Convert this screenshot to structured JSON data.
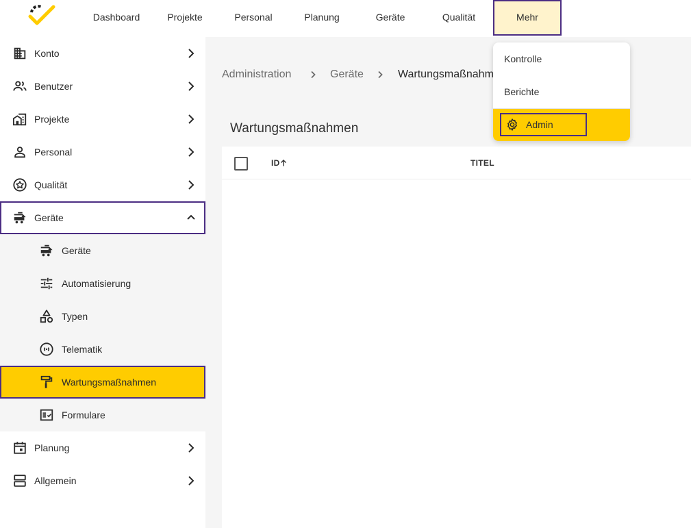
{
  "theme": {
    "accent": "#ffcc00",
    "highlight_border": "#4b2d83",
    "active_tab_bg": "#fff3cc",
    "content_bg": "#f5f5f5"
  },
  "topnav": {
    "items": [
      {
        "label": "Dashboard"
      },
      {
        "label": "Projekte"
      },
      {
        "label": "Personal"
      },
      {
        "label": "Planung"
      },
      {
        "label": "Geräte"
      },
      {
        "label": "Qualität"
      },
      {
        "label": "Mehr"
      }
    ],
    "active_index": 6
  },
  "dropdown": {
    "items": [
      {
        "label": "Kontrolle",
        "icon": ""
      },
      {
        "label": "Berichte",
        "icon": ""
      },
      {
        "label": "Admin",
        "icon": "gear-icon"
      }
    ]
  },
  "sidebar": {
    "items": [
      {
        "label": "Konto",
        "icon": "building-icon"
      },
      {
        "label": "Benutzer",
        "icon": "users-icon"
      },
      {
        "label": "Projekte",
        "icon": "buildings-icon"
      },
      {
        "label": "Personal",
        "icon": "person-icon"
      },
      {
        "label": "Qualität",
        "icon": "star-badge-icon"
      },
      {
        "label": "Geräte",
        "icon": "truck-icon",
        "expanded": true
      },
      {
        "label": "Planung",
        "icon": "calendar-icon"
      },
      {
        "label": "Allgemein",
        "icon": "storage-icon"
      }
    ],
    "sub_items": [
      {
        "label": "Geräte",
        "icon": "truck-icon"
      },
      {
        "label": "Automatisierung",
        "icon": "sliders-icon"
      },
      {
        "label": "Typen",
        "icon": "shapes-icon"
      },
      {
        "label": "Telematik",
        "icon": "signal-icon"
      },
      {
        "label": "Wartungsmaßnahmen",
        "icon": "paint-roller-icon",
        "selected": true
      },
      {
        "label": "Formulare",
        "icon": "form-checklist-icon"
      }
    ]
  },
  "breadcrumb": [
    "Administration",
    "Geräte",
    "Wartungsmaßnahmen"
  ],
  "page": {
    "title": "Wartungsmaßnahmen",
    "table": {
      "columns": [
        {
          "label": "ID",
          "sorted": "ascending"
        },
        {
          "label": "TITEL"
        }
      ],
      "rows": []
    }
  }
}
